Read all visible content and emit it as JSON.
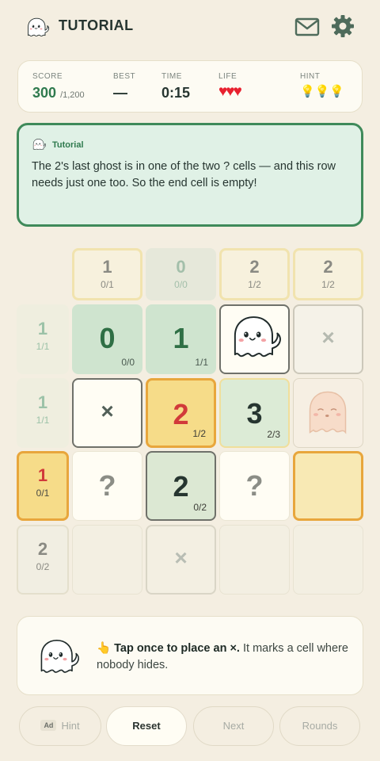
{
  "header": {
    "title": "TUTORIAL",
    "logo_icon": "ghost-icon",
    "mail_icon": "mail-icon",
    "settings_icon": "gear-icon"
  },
  "stats": {
    "score_label": "SCORE",
    "score": "300",
    "score_max": "/1,200",
    "best_label": "BEST",
    "best": "—",
    "time_label": "TIME",
    "time": "0:15",
    "life_label": "LIFE",
    "life": "♥♥♥",
    "life_count": 3,
    "hint_label": "HINT",
    "hint": "💡💡💡",
    "hint_count": 3
  },
  "tutorial": {
    "label": "Tutorial",
    "text": "The 2's last ghost is in one of the two ? cells — and this row needs just one too. So the end cell is empty!"
  },
  "column_clues": [
    {
      "value": "1",
      "progress": "0/1"
    },
    {
      "value": "0",
      "progress": "0/0"
    },
    {
      "value": "2",
      "progress": "1/2"
    },
    {
      "value": "2",
      "progress": "1/2"
    }
  ],
  "row_clues": [
    {
      "value": "1",
      "progress": "1/1"
    },
    {
      "value": "1",
      "progress": "1/1"
    },
    {
      "value": "1",
      "progress": "0/1"
    },
    {
      "value": "2",
      "progress": "0/2"
    }
  ],
  "grid": {
    "r1": [
      {
        "value": "0",
        "progress": "0/0"
      },
      {
        "value": "1",
        "progress": "1/1"
      },
      {
        "content": "ghost"
      },
      {
        "mark": "×"
      }
    ],
    "r2": [
      {
        "mark": "×"
      },
      {
        "value": "2",
        "progress": "1/2"
      },
      {
        "value": "3",
        "progress": "2/3"
      },
      {
        "content": "sleeping-ghost"
      }
    ],
    "r3": [
      {
        "mark": "?"
      },
      {
        "value": "2",
        "progress": "0/2"
      },
      {
        "mark": "?"
      },
      {
        "content": "empty"
      }
    ],
    "r4": [
      {
        "content": "empty"
      },
      {
        "mark": "×"
      },
      {
        "content": "empty"
      },
      {
        "content": "empty"
      }
    ]
  },
  "hint_card": {
    "icon": "pointing-hand",
    "pointer": "👆",
    "bold": "Tap once to place an ×.",
    "text": " It marks a cell where nobody hides."
  },
  "buttons": {
    "ad_badge": "Ad",
    "hint": "Hint",
    "reset": "Reset",
    "next": "Next",
    "rounds": "Rounds"
  },
  "colors": {
    "accent": "#3f8a5a",
    "highlight": "#e8a63c",
    "life": "#e8202e",
    "background": "#f4eee1"
  }
}
